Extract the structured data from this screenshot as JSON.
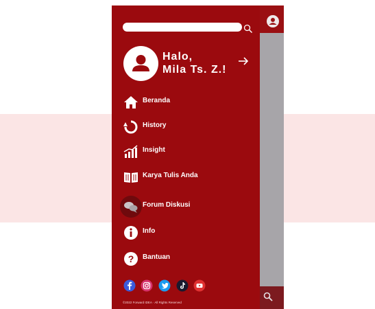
{
  "search": {
    "placeholder": ""
  },
  "profile": {
    "greeting_line1": "Halo,",
    "greeting_line2": "Mila Ts. Z.!"
  },
  "nav": {
    "items": [
      {
        "label": "Beranda",
        "icon": "home-icon"
      },
      {
        "label": "History",
        "icon": "history-icon"
      },
      {
        "label": "Insight",
        "icon": "insight-chart-icon"
      },
      {
        "label": "Karya Tulis Anda",
        "icon": "book-icon"
      },
      {
        "label": "Forum Diskusi",
        "icon": "chat-bubbles-icon",
        "active": true
      },
      {
        "label": "Info",
        "icon": "info-icon"
      },
      {
        "label": "Bantuan",
        "icon": "help-icon"
      }
    ]
  },
  "social": [
    "facebook-icon",
    "instagram-icon",
    "twitter-icon",
    "tiktok-icon",
    "youtube-icon"
  ],
  "footer": {
    "copyright": "©2022 Forward IDEA ·   All Rights Reserved"
  },
  "colors": {
    "drawer": "#9b0a0e",
    "backdrop": "#a7a5a9",
    "band": "#fbe5e5",
    "highlight": "#6f0a0d"
  }
}
